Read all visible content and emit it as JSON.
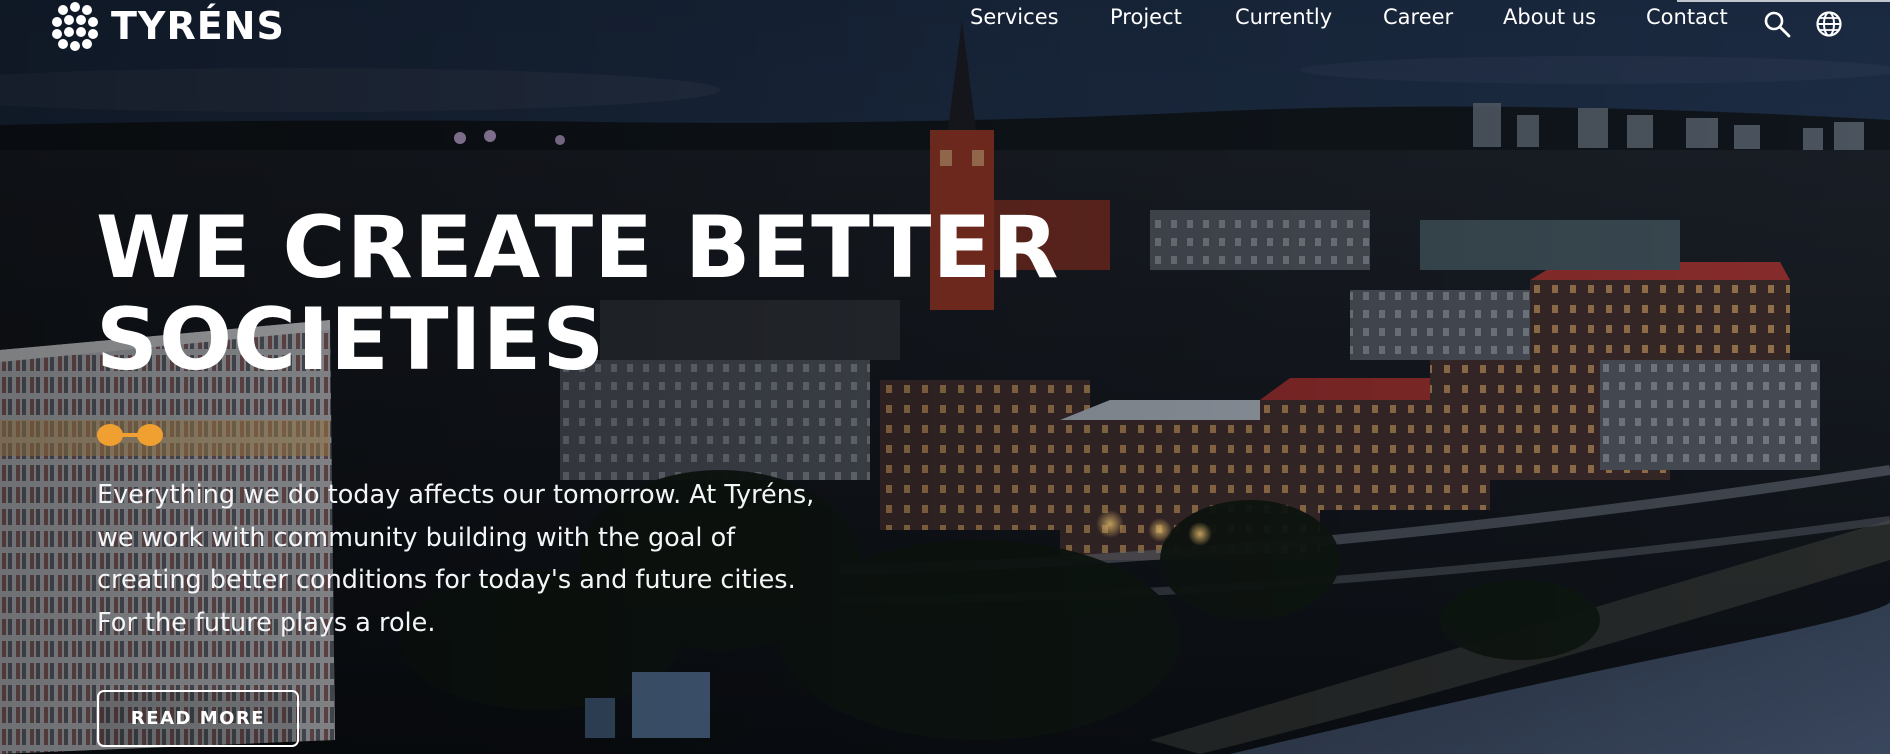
{
  "brand": {
    "name": "TYRÉNS",
    "logo_icon": "tyrens-dots-logo-icon"
  },
  "nav": {
    "items": [
      {
        "label": "Services"
      },
      {
        "label": "Project"
      },
      {
        "label": "Currently"
      },
      {
        "label": "Career"
      },
      {
        "label": "About us"
      },
      {
        "label": "Contact"
      }
    ],
    "icons": [
      "search-icon",
      "globe-icon"
    ]
  },
  "hero": {
    "headline_line1": "WE CREATE BETTER",
    "headline_line2": "SOCIETIES",
    "lead": "Everything we do today affects our tomorrow. At Tyréns, we work with community building with the goal of creating better conditions for today's and future cities. For the future plays a role.",
    "cta_label": "READ MORE",
    "background": "night-aerial-city-photo"
  },
  "colors": {
    "accent": "#f0a030",
    "text": "#ffffff",
    "sky": "#1b2c44"
  }
}
